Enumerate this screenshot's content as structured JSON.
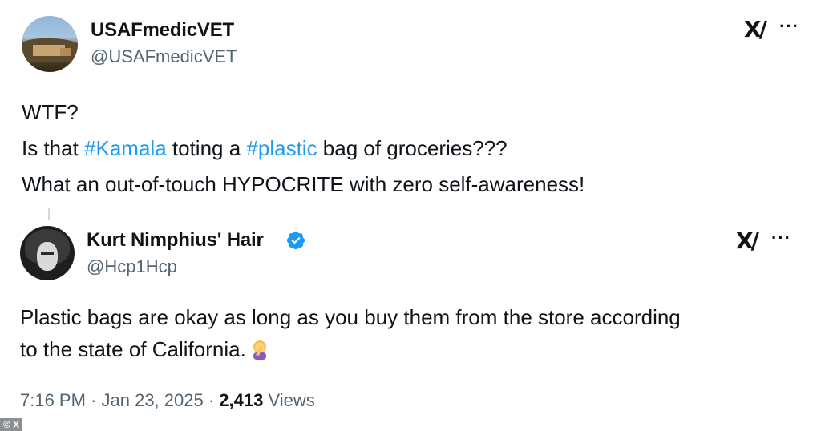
{
  "quoted": {
    "display_name": "USAFmedicVET",
    "handle": "@USAFmedicVET",
    "text_lines": [
      [
        {
          "t": "WTF?",
          "tag": false
        }
      ],
      [
        {
          "t": "Is that ",
          "tag": false
        },
        {
          "t": "#Kamala",
          "tag": true
        },
        {
          "t": " toting a ",
          "tag": false
        },
        {
          "t": "#plastic",
          "tag": true
        },
        {
          "t": " bag of groceries???",
          "tag": false
        }
      ],
      [
        {
          "t": "What an out-of-touch HYPOCRITE with zero self-awareness!",
          "tag": false
        }
      ]
    ]
  },
  "main": {
    "display_name": "Kurt Nimphius' Hair",
    "verified": true,
    "handle": "@Hcp1Hcp",
    "text_line1": "Plastic bags are okay as long as you buy them from the store according",
    "text_line2": "to the state of California.",
    "emoji": "woman-facepalming",
    "time": "7:16 PM",
    "sep1": " · ",
    "date": "Jan 23, 2025",
    "sep2": " · ",
    "views_count": "2,413",
    "views_label": " Views"
  },
  "icons": {
    "grok": "x-grok-icon",
    "more": "more-icon",
    "x_logo_glyph": "X/",
    "more_glyph": "···"
  },
  "image_credit": "© X",
  "colors": {
    "hashtag": "#1d9bf0",
    "secondary_text": "#536471",
    "verified": "#1d9bf0"
  }
}
